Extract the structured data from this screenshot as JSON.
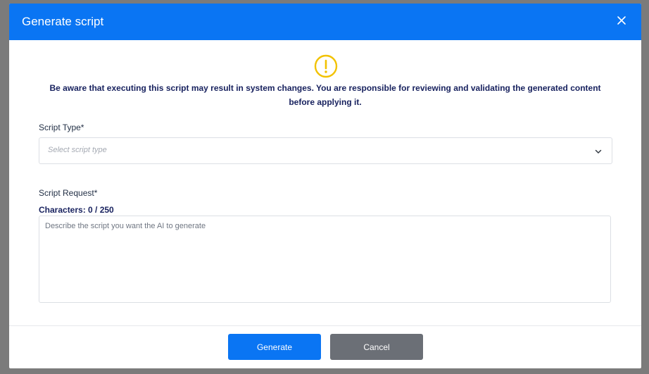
{
  "dialog": {
    "title": "Generate script",
    "close_icon": "close-icon",
    "warning_icon": "exclamation-circle-icon",
    "warning_text": "Be aware that executing this script may result in system changes. You are responsible for reviewing and validating the generated content before applying it."
  },
  "script_type": {
    "label": "Script Type*",
    "placeholder": "Select script type",
    "icon": "chevron-down-icon"
  },
  "script_request": {
    "label": "Script Request*",
    "characters": "Characters: 0 / 250",
    "placeholder": "Describe the script you want the AI to generate",
    "value": ""
  },
  "footer": {
    "generate_label": "Generate",
    "cancel_label": "Cancel"
  },
  "colors": {
    "accent": "#0a75f3",
    "warning": "#f2c200",
    "cancel": "#6b6f76",
    "text_dark": "#17215e"
  }
}
